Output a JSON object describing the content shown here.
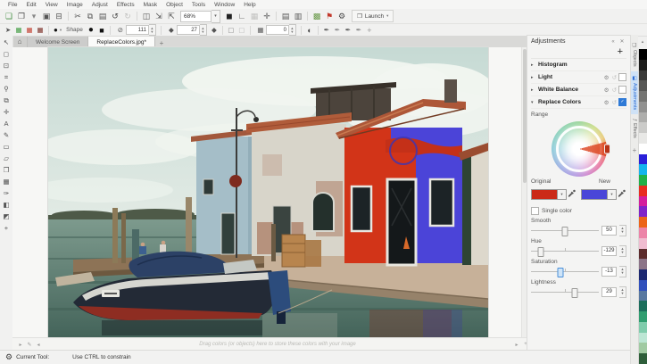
{
  "menu_bar": {
    "items": [
      "File",
      "Edit",
      "View",
      "Image",
      "Adjust",
      "Effects",
      "Mask",
      "Object",
      "Tools",
      "Window",
      "Help"
    ]
  },
  "toolbar": {
    "zoom_level": "68%",
    "zoom_caret": "▾",
    "launch": {
      "label": "Launch",
      "glyph": "❒",
      "caret": "▾"
    },
    "icons_left": [
      {
        "name": "new-document-icon",
        "glyph": "❏",
        "color": "#3d8a3d"
      },
      {
        "name": "open-icon",
        "glyph": "❐"
      },
      {
        "name": "open-caret-icon",
        "glyph": "▾",
        "color": "#888"
      },
      {
        "name": "save-icon",
        "glyph": "▣"
      },
      {
        "name": "print-icon",
        "glyph": "⊟"
      },
      {
        "name": "separator",
        "sep": true
      },
      {
        "name": "cut-icon",
        "glyph": "✂"
      },
      {
        "name": "copy-icon",
        "glyph": "⧉"
      },
      {
        "name": "paste-icon",
        "glyph": "▤"
      },
      {
        "name": "undo-icon",
        "glyph": "↺",
        "color": "#444"
      },
      {
        "name": "redo-icon",
        "glyph": "↻",
        "color": "#c2c2c0"
      },
      {
        "name": "separator",
        "sep": true
      },
      {
        "name": "full-screen-preview-icon",
        "glyph": "◫"
      },
      {
        "name": "import-icon",
        "glyph": "⇲"
      },
      {
        "name": "export-icon",
        "glyph": "⇱"
      }
    ],
    "icons_right": [
      {
        "name": "fit-to-screen-icon",
        "glyph": "◼",
        "color": "#222"
      },
      {
        "name": "rulers-icon",
        "glyph": "∟"
      },
      {
        "name": "grid-icon",
        "glyph": "▦",
        "color": "#c2c2c0"
      },
      {
        "name": "snap-icon",
        "glyph": "✛"
      },
      {
        "name": "separator",
        "sep": true
      },
      {
        "name": "proof-settings-icon",
        "glyph": "▤"
      },
      {
        "name": "page-preview-icon",
        "glyph": "▥"
      },
      {
        "name": "separator",
        "sep": true
      },
      {
        "name": "palette-editor-icon",
        "glyph": "▩",
        "color": "#6a9a4a"
      },
      {
        "name": "review-flag-icon",
        "glyph": "⚑",
        "color": "#c2372a"
      },
      {
        "name": "options-gear-icon",
        "glyph": "⚙",
        "color": "#444"
      }
    ]
  },
  "property_bar": {
    "shape_label": "Shape",
    "nib_preview_glyph": "●",
    "nib_caret": "▾",
    "round_nib_glyph": "●",
    "square_nib_glyph": "■",
    "size": {
      "icon": "⊘",
      "value": "111"
    },
    "feather": {
      "icon": "◆",
      "value": "27"
    },
    "transparency": {
      "icon": "▦",
      "value": "0"
    },
    "soft_edge_glyph": "◆",
    "merge_mode_glyph": "◐",
    "expand_label": "+",
    "icons_left": [
      {
        "name": "brush-preset-icon",
        "glyph": "➤",
        "color": "#555"
      },
      {
        "name": "symmetry-green-icon",
        "glyph": "▦",
        "color": "#3d9a3d"
      },
      {
        "name": "symmetry-red-icon",
        "glyph": "▦",
        "color": "#c03a2a"
      },
      {
        "name": "symmetry-dark-icon",
        "glyph": "▦",
        "color": "#7a2a22"
      }
    ],
    "dashed_icons": [
      {
        "name": "anti-alias-icon",
        "glyph": "▢",
        "color": "#888"
      },
      {
        "name": "feather-edge-icon",
        "glyph": "▢",
        "color": "#bbb"
      }
    ],
    "ink_icons": [
      {
        "name": "brush-settings-icon",
        "glyph": "✒"
      },
      {
        "name": "brush-texture-icon",
        "glyph": "✒",
        "color": "#888"
      },
      {
        "name": "brush-edge-icon",
        "glyph": "✒"
      },
      {
        "name": "brush-tilt-icon",
        "glyph": "✒",
        "color": "#888"
      }
    ]
  },
  "tab_bar": {
    "home_glyph": "⌂",
    "tabs": [
      {
        "label": "Welcome Screen"
      },
      {
        "label": "ReplaceColors.jpg*"
      }
    ],
    "add_label": "+"
  },
  "toolbox": {
    "items": [
      {
        "name": "pick-tool",
        "glyph": "↖"
      },
      {
        "name": "mask-rectangle-tool",
        "glyph": "◻"
      },
      {
        "name": "mask-transform-tool",
        "glyph": "⊡"
      },
      {
        "name": "crop-tool",
        "glyph": "⌗"
      },
      {
        "name": "zoom-tool",
        "glyph": "⚲"
      },
      {
        "name": "clone-tool",
        "glyph": "⧉"
      },
      {
        "name": "touch-up-tool",
        "glyph": "✛"
      },
      {
        "name": "text-tool",
        "glyph": "A"
      },
      {
        "name": "paint-tool",
        "glyph": "✎"
      },
      {
        "name": "rectangle-tool",
        "glyph": "▭"
      },
      {
        "name": "eraser-tool",
        "glyph": "▱"
      },
      {
        "name": "object-pick-tool",
        "glyph": "❐"
      },
      {
        "name": "transparency-tool",
        "glyph": "▦"
      },
      {
        "name": "eyedropper-tool",
        "glyph": "✑"
      },
      {
        "name": "fill-tool",
        "glyph": "◧"
      },
      {
        "name": "color-swatches",
        "glyph": "◩"
      },
      {
        "name": "add-tool-button",
        "glyph": "+"
      }
    ]
  },
  "docker": {
    "title": "Adjustments",
    "title_icons": [
      {
        "name": "dock-arrows-icon",
        "glyph": "«"
      },
      {
        "name": "close-docker-icon",
        "glyph": "✕"
      }
    ],
    "add_label": "+",
    "sections": [
      {
        "label": "Histogram",
        "arrow": "▸",
        "enabled": false,
        "has_icons": false
      },
      {
        "label": "Light",
        "arrow": "▸",
        "enabled": false,
        "has_icons": true
      },
      {
        "label": "White Balance",
        "arrow": "▸",
        "enabled": false,
        "has_icons": true
      },
      {
        "label": "Replace Colors",
        "arrow": "▾",
        "enabled": true,
        "has_icons": true
      }
    ],
    "replace_colors": {
      "range_label": "Range",
      "original_label": "Original",
      "new_label": "New",
      "original_color": "#cb2a18",
      "new_color": "#4a46d8",
      "single_color_label": "Single color",
      "single_color_checked": false,
      "sliders": [
        {
          "label": "Smooth",
          "value": "50",
          "percent": 50
        },
        {
          "label": "Hue",
          "value": "-129",
          "percent": 14
        },
        {
          "label": "Saturation",
          "value": "-13",
          "percent": 43,
          "active": true
        },
        {
          "label": "Lightness",
          "value": "29",
          "percent": 64
        }
      ]
    }
  },
  "side_tabs": {
    "items": [
      {
        "label": "Objects",
        "glyph": "❑"
      },
      {
        "label": "Adjustments",
        "glyph": "◧",
        "active": true
      },
      {
        "label": "Effects",
        "glyph": "ƒ"
      }
    ],
    "add_label": "+"
  },
  "color_palette": {
    "scroll_up_glyph": "▴",
    "colors": [
      "#000000",
      "#1d1d1b",
      "#3a3a38",
      "#575755",
      "#747472",
      "#919190",
      "#aeaeac",
      "#cbcbc9",
      "#e8e8e6",
      "#ffffff",
      "#2a20d8",
      "#14b4ec",
      "#20b048",
      "#e82c20",
      "#d41e9c",
      "#8024c8",
      "#ec6418",
      "#ec84a8",
      "#f0bcd0",
      "#5c2c2c",
      "#8c7488",
      "#1c2870",
      "#3050bc",
      "#5878a0",
      "#1c6e5c",
      "#309e70",
      "#80ccac",
      "#bce6d4",
      "#a0caa2",
      "#2e5e3a"
    ]
  },
  "canvas": {
    "palette_hint": "Drag colors (or objects) here to store these colors with your image",
    "hint_icons_left": [
      {
        "name": "palette-options-icon",
        "glyph": "▸"
      },
      {
        "name": "palette-eyedropper-icon",
        "glyph": "✎"
      },
      {
        "name": "palette-scroll-left-icon",
        "glyph": "◂"
      }
    ],
    "hint_icons_right": [
      {
        "name": "palette-scroll-right-icon",
        "glyph": "▸"
      },
      {
        "name": "palette-add-color-icon",
        "glyph": "+"
      }
    ]
  },
  "status_bar": {
    "gear_glyph": "⚙",
    "current_tool_label": "Current Tool:",
    "tool_hint": "Use CTRL to constrain"
  }
}
